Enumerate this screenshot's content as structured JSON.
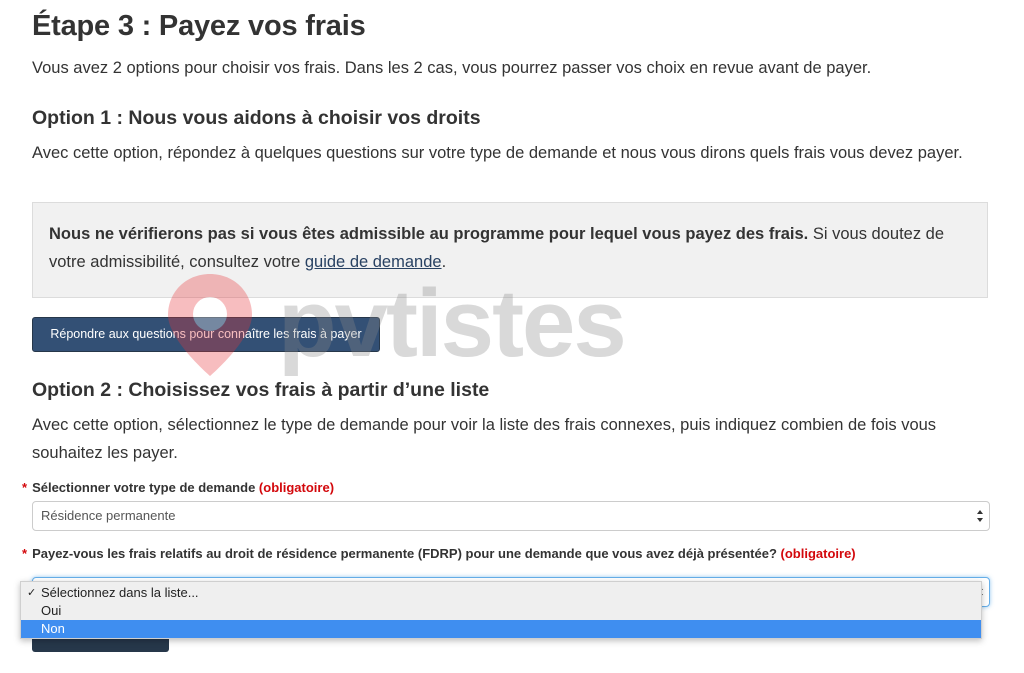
{
  "step": {
    "title": "Étape 3 : Payez vos frais",
    "intro": "Vous avez 2 options pour choisir vos frais. Dans les 2 cas, vous pourrez passer vos choix en revue avant de payer."
  },
  "option1": {
    "heading": "Option 1 : Nous vous aidons à choisir vos droits",
    "text": "Avec cette option, répondez à quelques questions sur votre type de demande et nous vous dirons quels frais vous devez payer.",
    "notice_bold": "Nous ne vérifierons pas si vous êtes admissible au programme pour lequel vous payez des frais.",
    "notice_text": " Si vous doutez de votre admissibilité, consultez votre ",
    "notice_link": "guide de demande",
    "notice_end": ".",
    "button_label": "Répondre aux questions pour connaître les frais à payer"
  },
  "option2": {
    "heading": "Option 2 : Choisissez vos frais à partir d’une liste",
    "text": "Avec cette option, sélectionnez le type de demande pour voir la liste des frais connexes, puis indiquez combien de fois vous souhaitez les payer.",
    "field1": {
      "star": "*",
      "label": "Sélectionner votre type de demande",
      "required": "(obligatoire)",
      "value": "Résidence permanente"
    },
    "field2": {
      "star": "*",
      "label": "Payez-vous les frais relatifs au droit de résidence permanente (FDRP) pour une demande que vous avez déjà présentée?",
      "required": "(obligatoire)",
      "options": [
        "Sélectionnez dans la liste...",
        "Oui",
        "Non"
      ],
      "checked_option": "Sélectionnez dans la liste...",
      "highlighted_option": "Non"
    }
  },
  "watermark": {
    "text": "pvtistes"
  },
  "colors": {
    "primary_button": "#335075",
    "required_red": "#d3080c",
    "link": "#284162",
    "highlight": "#3f8ef0",
    "watermark_pin": "#e8353a"
  }
}
